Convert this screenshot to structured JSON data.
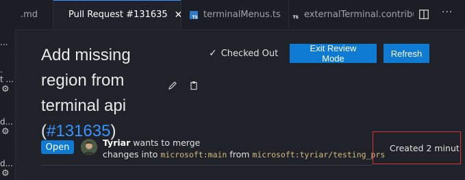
{
  "tabs": [
    {
      "label": ".md"
    },
    {
      "label": "Pull Request #131635",
      "close": "✕"
    },
    {
      "label": "terminalMenus.ts"
    },
    {
      "label": "externalTerminal.contribut"
    }
  ],
  "sidebar": {
    "items": [
      {
        "text": "..."
      },
      {
        "text": "t ..."
      },
      {
        "text": "d..."
      },
      {
        "text": "d..."
      }
    ]
  },
  "pr": {
    "title_text": "Add missing region from terminal api",
    "paren_open": "(",
    "number": "#131635",
    "paren_close": ")",
    "checked_out_label": "Checked Out",
    "exit_review_label": "Exit Review Mode",
    "refresh_label": "Refresh",
    "status_badge": "Open",
    "author": "Tyriar",
    "merge_text_1": " wants to merge",
    "merge_text_2": "changes into ",
    "base_branch": "microsoft:main",
    "from_text": " from ",
    "head_branch": "microsoft:tyriar/testing_prs",
    "created_text": "Created 2 minut"
  },
  "icons": {
    "check": "✓",
    "close": "✕",
    "more": "···"
  },
  "colors": {
    "accent": "#0e7ad1",
    "link": "#3794ff",
    "branch": "#d7ba7d",
    "highlight_box": "#e03030"
  }
}
